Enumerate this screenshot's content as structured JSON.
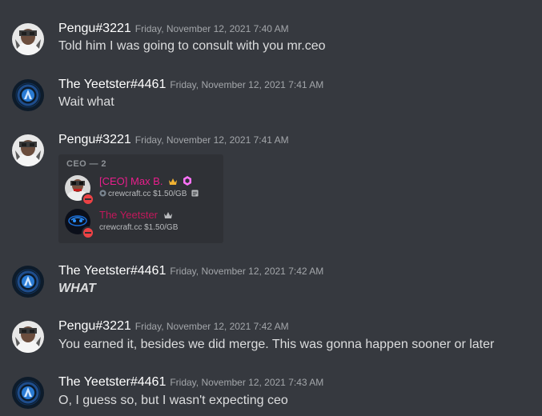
{
  "messages": [
    {
      "username": "Pengu#3221",
      "timestamp": "Friday, November 12, 2021 7:40 AM",
      "content": "Told him I was going to consult with you mr.ceo",
      "avatar": "pengu-avatar"
    },
    {
      "username": "The Yeetster#4461",
      "timestamp": "Friday, November 12, 2021 7:41 AM",
      "content": "Wait what",
      "avatar": "yeetster-avatar"
    },
    {
      "username": "Pengu#3221",
      "timestamp": "Friday, November 12, 2021 7:41 AM",
      "content": "",
      "avatar": "pengu-avatar",
      "attachment": {
        "role_header": "CEO — 2",
        "members": [
          {
            "name": "[CEO] Max B.",
            "name_color": "#e91e8c",
            "subtitle": "crewcraft.cc $1.50/GB",
            "badges": [
              "crown-icon",
              "nitro-boost-icon"
            ],
            "status": "do-not-disturb"
          },
          {
            "name": "The Yeetster",
            "name_color": "#c2185b",
            "subtitle": "crewcraft.cc $1.50/GB",
            "badges": [
              "crown-icon"
            ],
            "status": "do-not-disturb"
          }
        ]
      }
    },
    {
      "username": "The Yeetster#4461",
      "timestamp": "Friday, November 12, 2021 7:42 AM",
      "content": "WHAT",
      "avatar": "yeetster-avatar"
    },
    {
      "username": "Pengu#3221",
      "timestamp": "Friday, November 12, 2021 7:42 AM",
      "content": "You earned it, besides we did merge. This was gonna happen sooner or later",
      "avatar": "pengu-avatar"
    },
    {
      "username": "The Yeetster#4461",
      "timestamp": "Friday, November 12, 2021 7:43 AM",
      "content": "O, I guess so, but I wasn't expecting ceo",
      "avatar": "yeetster-avatar"
    }
  ],
  "colors": {
    "background": "#36393f",
    "username": "#ffffff",
    "timestamp": "#a3a6aa",
    "text": "#dcddde",
    "embed_bg": "#2f3136",
    "dnd_status": "#ed4245",
    "crown_gold": "#f0b232",
    "crown_gray": "#b9bbbe"
  }
}
